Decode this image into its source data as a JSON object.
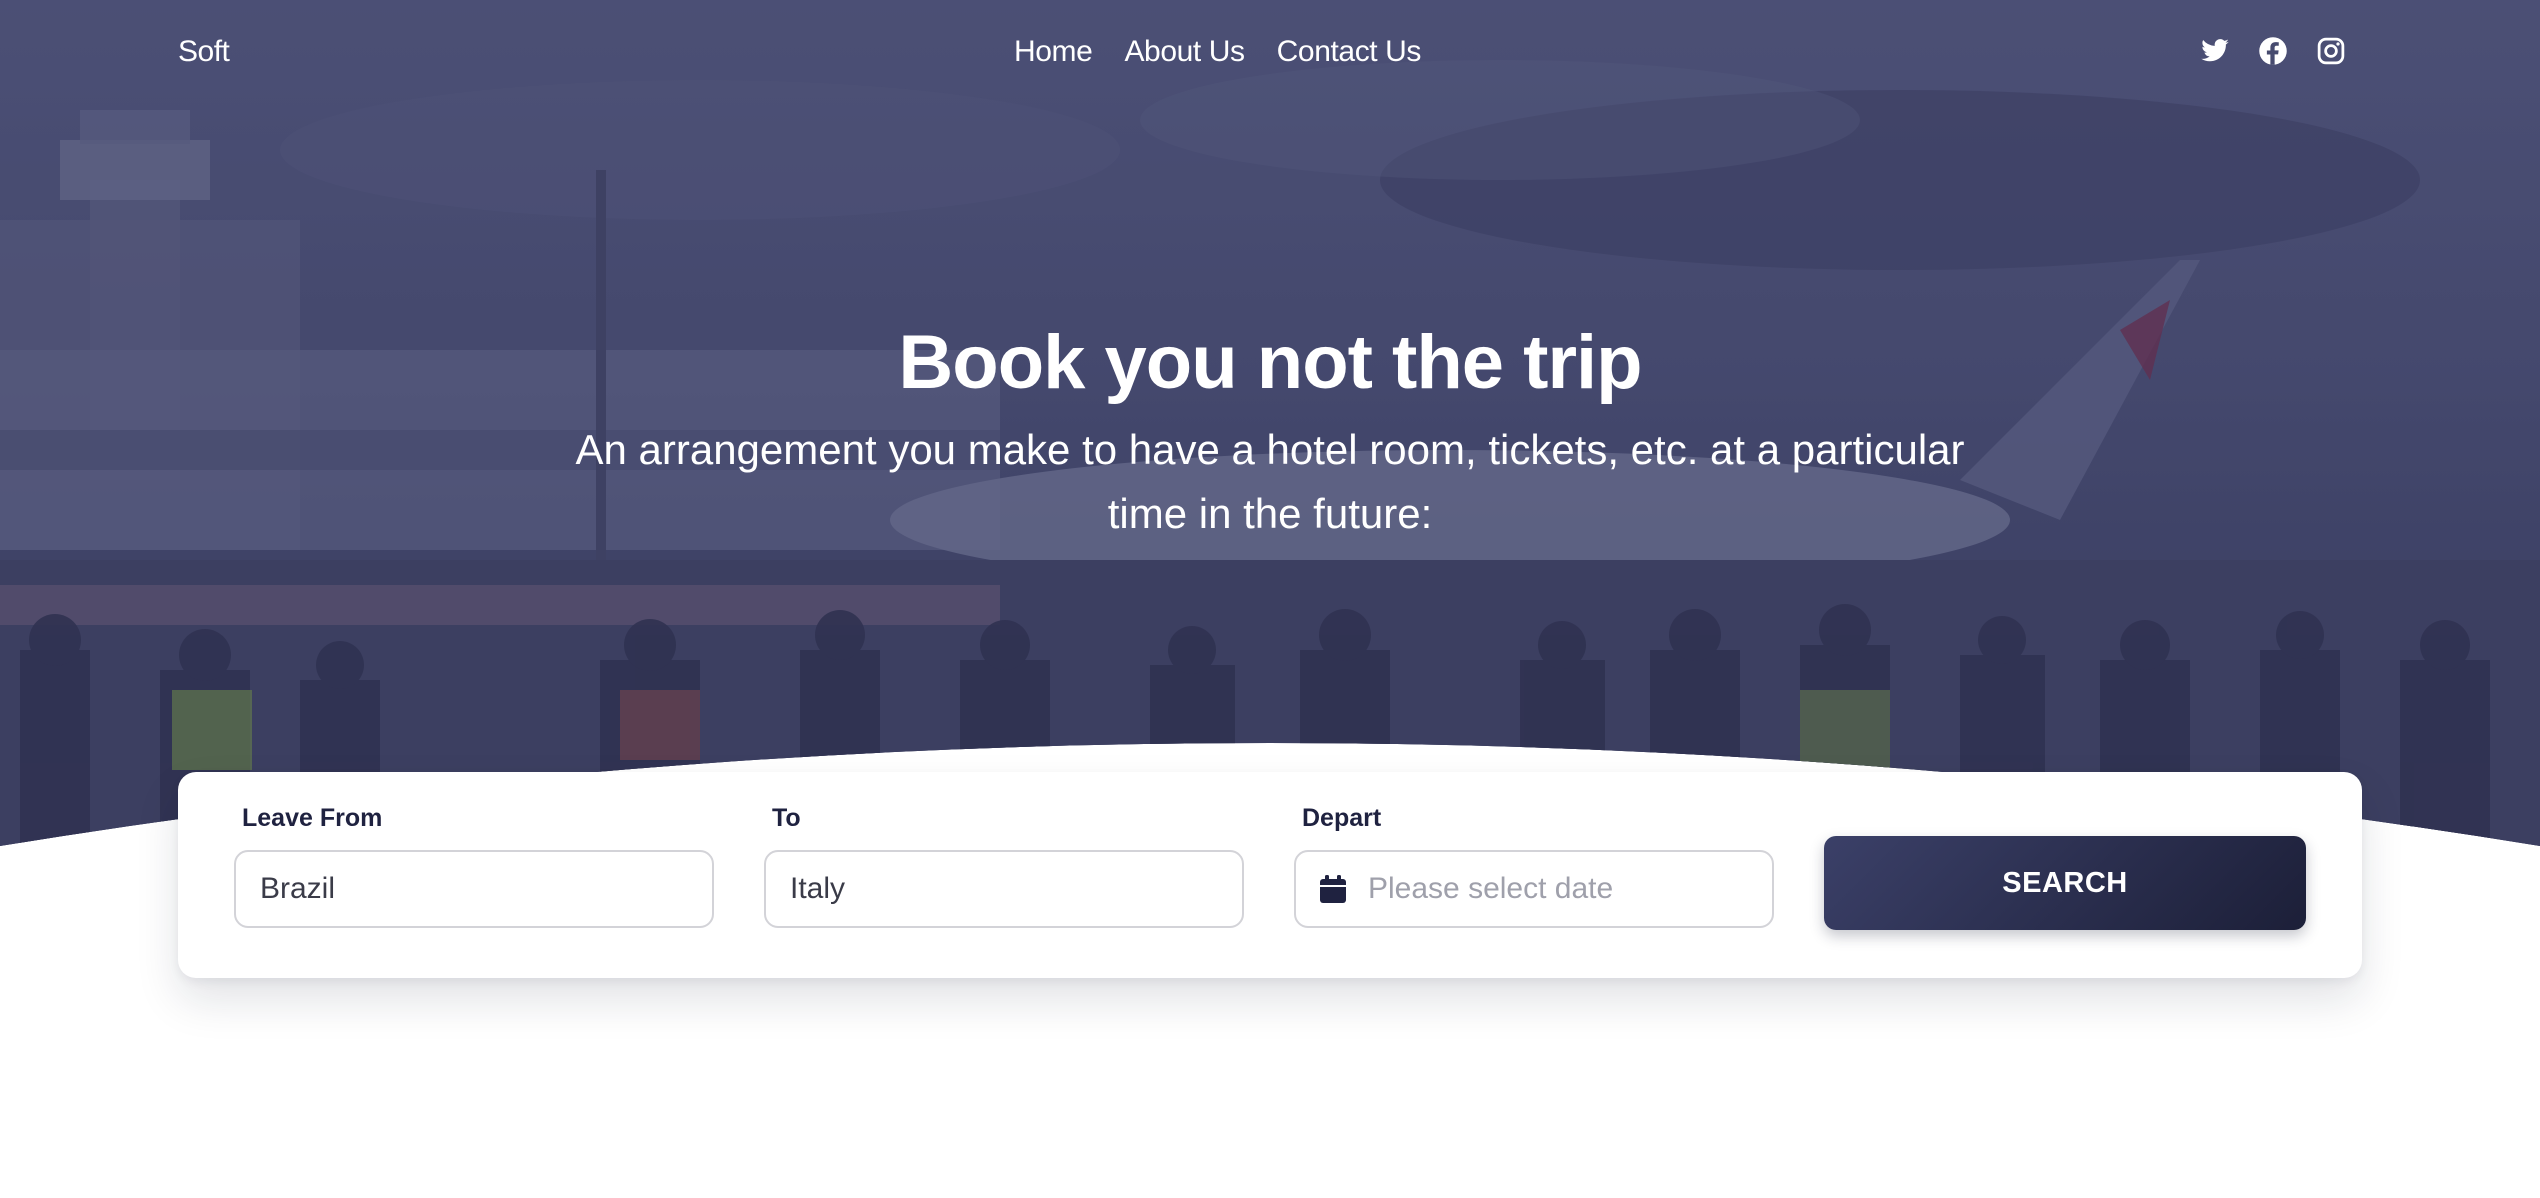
{
  "nav": {
    "brand": "Soft",
    "links": [
      "Home",
      "About Us",
      "Contact Us"
    ],
    "socials": [
      "twitter-icon",
      "facebook-icon",
      "instagram-icon"
    ]
  },
  "hero": {
    "title": "Book you not the trip",
    "subtitle": "An arrangement you make to have a hotel room, tickets, etc. at a particular time in the future:",
    "overlay_color": "#3b3f66"
  },
  "search": {
    "leave_from": {
      "label": "Leave From",
      "value": "Brazil"
    },
    "to": {
      "label": "To",
      "value": "Italy"
    },
    "depart": {
      "label": "Depart",
      "placeholder": "Please select date",
      "icon": "calendar-icon"
    },
    "button_label": "SEARCH"
  },
  "colors": {
    "dark_navy": "#1f2240",
    "button_start": "#3b4068",
    "button_end": "#1c1f38",
    "input_border": "#d3d3d8",
    "placeholder": "#9fa0ab"
  }
}
